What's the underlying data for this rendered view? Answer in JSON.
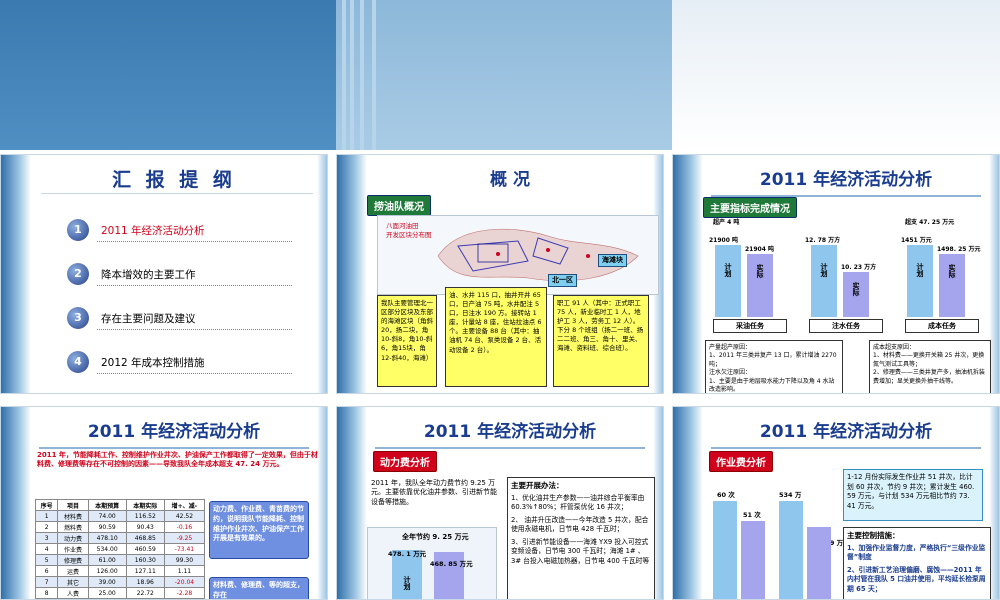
{
  "slide1": {
    "title": "汇 报 提 纲",
    "items": [
      {
        "num": "1",
        "label": "2011 年经济活动分析",
        "color": "#d0021b"
      },
      {
        "num": "2",
        "label": "降本增效的主要工作",
        "color": "#000000"
      },
      {
        "num": "3",
        "label": "存在主要问题及建议",
        "color": "#000000"
      },
      {
        "num": "4",
        "label": "2012 年成本控制措施",
        "color": "#000000"
      }
    ]
  },
  "slide2": {
    "title": "概        况",
    "section": "捞油队概况",
    "map_title": "八面河油田\n开发区块分布图",
    "map_label_1": "海滩块",
    "map_label_2": "北一区",
    "box1": "我队主要管理北一区部分区块及东部的海滩区块（角斜20，扬二块，角10-斜8，角10-斜6，角15块，角12-斜40，海滩）",
    "box2": "油、水井 115 口，抽井开井 65 口，日产油 75 吨，水井配注 5 口，日注水 190 方。接转站 1 座，计量站 8 座，住站拉油点 6 个。主要设备 88 台（其中：抽油机 74 台、泵类设备 2 台、活动设备 2 台）。",
    "box3": "职工 91 人（其中：正式职工 75 人，新业临时工 1 人，地护工 3 人，劳务工 12 人）。下分 8 个班组（扬二一班、扬二二班、角三、角十、里关、海滩、资料班、综合班）。"
  },
  "slide3": {
    "title": "2011 年经济活动分析",
    "section": "主要指标完成情况",
    "charts": [
      {
        "name": "采油任务",
        "plan": "21900 吨",
        "actual": "21904 吨",
        "note": "超产 4 吨"
      },
      {
        "name": "注水任务",
        "plan": "12. 78 万方",
        "actual": "10. 23 万方",
        "note": ""
      },
      {
        "name": "成本任务",
        "plan": "1451 万元",
        "actual": "1498. 25 万元",
        "note": "超支 47. 25 万元"
      }
    ],
    "plan_label": "计划",
    "actual_label": "实际",
    "left_box": "产量超产原因：\n1、2011 年三类井复产 13 口，累计增油 2270 吨；\n注水欠注原因：\n1、主要是由于地层吸水能力下降以及角 4 水站改造影响。",
    "right_box": "成本超支原因：\n1、材料费——更换开关箱 25 井次，更换氮气测试工具等；\n2、修理费——三类井复产多，抽油机拆装费增加；显关更换外抽干线等。"
  },
  "slide4": {
    "title": "2011 年经济活动分析",
    "intro": "2011 年，节能降耗工作、控制维护作业井次、护油保产工作都取得了一定效果，但由于材料费、修理费等存在不可控制的因素——导致我队全年成本超支 47. 24 万元。",
    "table_headers": [
      "序号",
      "项目",
      "本期预算",
      "本期实际",
      "增+、减-"
    ],
    "rows": [
      [
        "1",
        "材料费",
        "74.00",
        "116.52",
        "42.52"
      ],
      [
        "2",
        "燃料费",
        "90.59",
        "90.43",
        "-0.16"
      ],
      [
        "3",
        "动力费",
        "478.10",
        "468.85",
        "-9.25"
      ],
      [
        "4",
        "作业费",
        "534.00",
        "460.59",
        "-73.41"
      ],
      [
        "5",
        "修理费",
        "61.00",
        "160.30",
        "99.30"
      ],
      [
        "6",
        "运费",
        "126.00",
        "127.11",
        "1.11"
      ],
      [
        "7",
        "其它",
        "39.00",
        "18.96",
        "-20.04"
      ],
      [
        "8",
        "人费",
        "25.00",
        "22.72",
        "-2.28"
      ]
    ],
    "callout1": "动力费、作业费、青苗费的节约，说明我队节能降耗、控制维护作业井次、护油保产工作开展是有效果的。",
    "callout2": "材料费、修理费、等的超支，存在"
  },
  "slide5": {
    "title": "2011 年经济活动分析",
    "section": "动力费分析",
    "text": "2011 年，我队全年动力费节约 9.25 万元。主要依靠优化油井参数、引进新节能设备等措施。",
    "chart_note": "全年节约 9. 25 万元",
    "plan_val": "478. 1 万元",
    "actual_val": "468. 85 万元",
    "plan_label": "计划",
    "actual_label": "实际",
    "right_title": "主要开展办法：",
    "right_points": [
      "1、优化油井生产参数——油井综合平衡率由 60.3%↑80%；杆管泵优化 16 井次；",
      "2、 油井升压改造——今年改造 5 井次，配合使用永磁电机，日节电 428 千瓦时；",
      "3、引进新节能设备——海滩 YX9 投入可控式变频设备，日节电 300 千瓦时；海滩 1# 、3# 台投入电磁加热器，日节电 400 千瓦时等"
    ]
  },
  "slide6": {
    "title": "2011 年经济活动分析",
    "section": "作业费分析",
    "summary": "1-12 月份实际发生作业井 51 井次，比计划 60 井次，节约 9 井次；累计发生 460. 59 万元，与计划 534 万元相比节约 73. 41 万元。",
    "chart1": {
      "plan": "60 次",
      "actual": "51 次"
    },
    "chart2": {
      "plan": "534 万",
      "actual": "460. 59 万"
    },
    "plan_label": "计划",
    "actual_label": "实际",
    "measures_title": "主要控制措施：",
    "measures": [
      "1、加强作业监督力度，严格执行“三级作业监督”制度",
      "2、引进新工艺治理偏磨、腐蚀——2011 年内村管在我队 5 口油井使用，平均延长检泵周期 65 天；"
    ]
  }
}
